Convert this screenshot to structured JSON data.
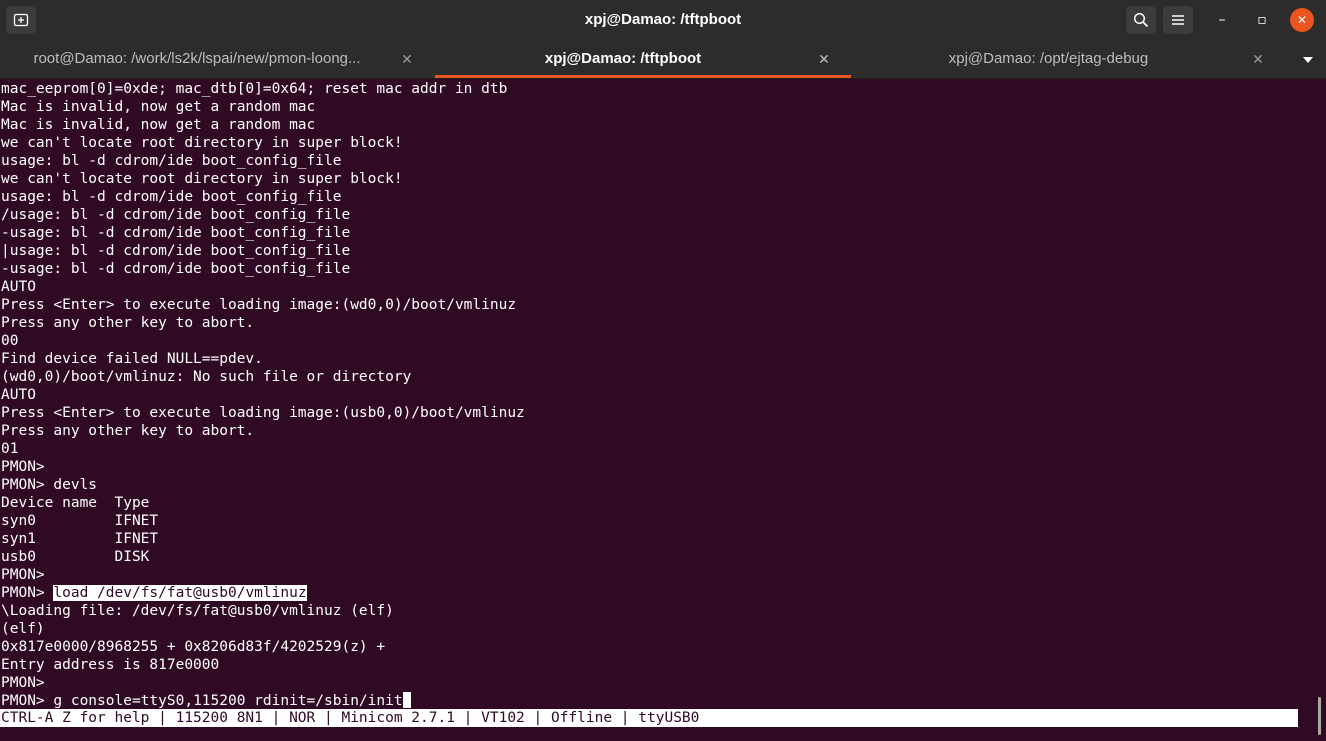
{
  "window": {
    "title": "xpj@Damao: /tftpboot",
    "minimize_glyph": "–",
    "maximize_glyph": "▫",
    "close_glyph": "✕"
  },
  "icons": {
    "new_tab": "new-tab-icon",
    "search": "search-icon",
    "menu": "hamburger-menu-icon",
    "tab_dropdown": "chevron-down-icon"
  },
  "colors": {
    "terminal_bg": "#300a24",
    "accent": "#e95420",
    "titlebar_bg": "#2c2c2c"
  },
  "tabs": [
    {
      "label": "root@Damao: /work/ls2k/lspai/new/pmon-loong...",
      "close": "✕"
    },
    {
      "label": "xpj@Damao: /tftpboot",
      "close": "✕",
      "active": true
    },
    {
      "label": "xpj@Damao: /opt/ejtag-debug",
      "close": "✕"
    }
  ],
  "terminal": {
    "lines": [
      "mac_eeprom[0]=0xde; mac_dtb[0]=0x64; reset mac addr in dtb",
      "Mac is invalid, now get a random mac",
      "Mac is invalid, now get a random mac",
      "we can't locate root directory in super block!",
      "usage: bl -d cdrom/ide boot_config_file",
      "we can't locate root directory in super block!",
      "usage: bl -d cdrom/ide boot_config_file",
      "/usage: bl -d cdrom/ide boot_config_file",
      "-usage: bl -d cdrom/ide boot_config_file",
      "|usage: bl -d cdrom/ide boot_config_file",
      "-usage: bl -d cdrom/ide boot_config_file",
      "AUTO",
      "Press <Enter> to execute loading image:(wd0,0)/boot/vmlinuz",
      "Press any other key to abort.",
      "00",
      "Find device failed NULL==pdev.",
      "(wd0,0)/boot/vmlinuz: No such file or directory",
      "AUTO",
      "Press <Enter> to execute loading image:(usb0,0)/boot/vmlinuz",
      "Press any other key to abort.",
      "01",
      "PMON>",
      "PMON> devls",
      "Device name  Type",
      "syn0         IFNET",
      "syn1         IFNET",
      "usb0         DISK",
      "PMON>"
    ],
    "load_prompt": "PMON> ",
    "load_command": "load /dev/fs/fat@usb0/vmlinuz",
    "after_lines": [
      "\\Loading file: /dev/fs/fat@usb0/vmlinuz (elf)",
      "(elf)",
      "0x817e0000/8968255 + 0x8206d83f/4202529(z) +",
      "Entry address is 817e0000",
      "PMON>"
    ],
    "current_prompt": "PMON> ",
    "current_input": "g console=ttyS0,115200 rdinit=/sbin/init"
  },
  "statusbar": {
    "text": "CTRL-A Z for help | 115200 8N1 | NOR | Minicom 2.7.1 | VT102 | Offline | ttyUSB0"
  }
}
